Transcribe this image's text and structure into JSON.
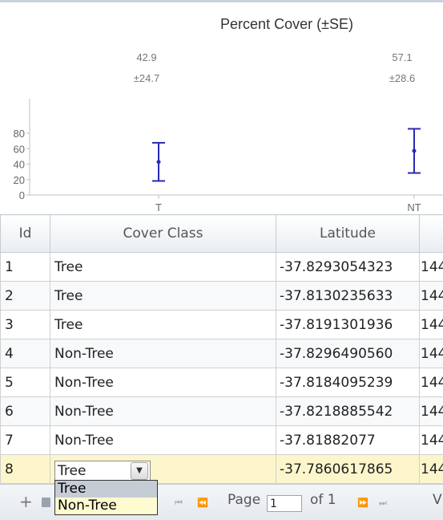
{
  "chart_data": {
    "type": "errorbar",
    "title": "Percent Cover (±SE)",
    "categories": [
      "T",
      "NT"
    ],
    "values": [
      42.9,
      57.1
    ],
    "errors": [
      24.7,
      28.6
    ],
    "value_labels": [
      "42.9",
      "57.1"
    ],
    "error_labels": [
      "±24.7",
      "±28.6"
    ],
    "y_ticks": [
      "0",
      "20",
      "40",
      "60",
      "80"
    ],
    "ylim": [
      0,
      90
    ],
    "grid": false,
    "color": "#2a2ab5"
  },
  "grid": {
    "columns": [
      "Id",
      "Cover Class",
      "Latitude"
    ],
    "rows": [
      {
        "id": "1",
        "cover": "Tree",
        "lat": "-37.8293054323",
        "lon": "144"
      },
      {
        "id": "2",
        "cover": "Tree",
        "lat": "-37.8130235633",
        "lon": "144"
      },
      {
        "id": "3",
        "cover": "Tree",
        "lat": "-37.8191301936",
        "lon": "144"
      },
      {
        "id": "4",
        "cover": "Non-Tree",
        "lat": "-37.8296490560",
        "lon": "144"
      },
      {
        "id": "5",
        "cover": "Non-Tree",
        "lat": "-37.8184095239",
        "lon": "144"
      },
      {
        "id": "6",
        "cover": "Non-Tree",
        "lat": "-37.8218885542",
        "lon": "144"
      },
      {
        "id": "7",
        "cover": "Non-Tree",
        "lat": "-37.81882077",
        "lon": "144"
      },
      {
        "id": "8",
        "cover": "Tree",
        "lat": "-37.7860617865",
        "lon": "144"
      }
    ],
    "editor": {
      "selected": "Tree",
      "options": [
        "Tree",
        "Non-Tree"
      ]
    }
  },
  "pager": {
    "page_label": "Page",
    "page_value": "1",
    "of_label": "of 1",
    "add_symbol": "+",
    "first_symbol": "⏮",
    "prev_symbol": "⏪",
    "next_symbol": "⏩",
    "last_symbol": "⏭",
    "view_label": "V"
  }
}
